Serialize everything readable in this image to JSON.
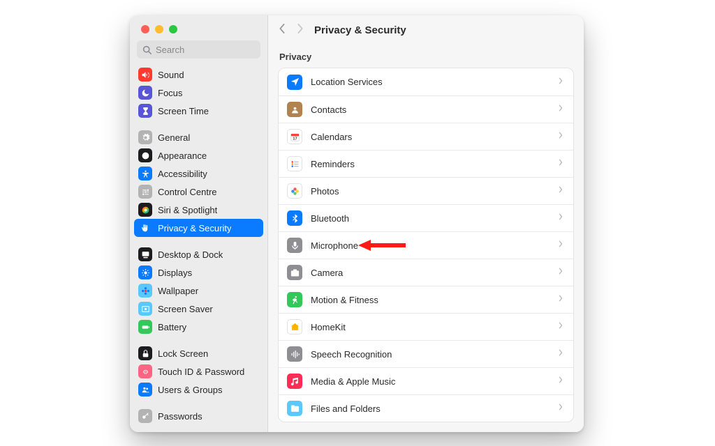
{
  "search": {
    "placeholder": "Search"
  },
  "title": "Privacy & Security",
  "section_header": "Privacy",
  "sidebar": {
    "group1": [
      {
        "label": "Sound",
        "icon": "sound",
        "bg": "#FF3B30"
      },
      {
        "label": "Focus",
        "icon": "moon",
        "bg": "#5856D6"
      },
      {
        "label": "Screen Time",
        "icon": "hourglass",
        "bg": "#5856D6"
      }
    ],
    "group2": [
      {
        "label": "General",
        "icon": "gear",
        "bg": "#B3B3B3"
      },
      {
        "label": "Appearance",
        "icon": "appearance",
        "bg": "#1C1C1E"
      },
      {
        "label": "Accessibility",
        "icon": "access",
        "bg": "#0A7AFF"
      },
      {
        "label": "Control Centre",
        "icon": "sliders",
        "bg": "#B3B3B3"
      },
      {
        "label": "Siri & Spotlight",
        "icon": "siri",
        "bg": "grad-siri"
      },
      {
        "label": "Privacy & Security",
        "icon": "hand",
        "bg": "#0A7AFF",
        "selected": true
      }
    ],
    "group3": [
      {
        "label": "Desktop & Dock",
        "icon": "dock",
        "bg": "#1C1C1E"
      },
      {
        "label": "Displays",
        "icon": "sun",
        "bg": "#0A7AFF"
      },
      {
        "label": "Wallpaper",
        "icon": "flower",
        "bg": "#5AC8FA"
      },
      {
        "label": "Screen Saver",
        "icon": "frame",
        "bg": "#5AC8FA"
      },
      {
        "label": "Battery",
        "icon": "battery",
        "bg": "#34C759"
      }
    ],
    "group4": [
      {
        "label": "Lock Screen",
        "icon": "lock",
        "bg": "#1C1C1E"
      },
      {
        "label": "Touch ID & Password",
        "icon": "finger",
        "bg": "#FF6482"
      },
      {
        "label": "Users & Groups",
        "icon": "users",
        "bg": "#0A7AFF"
      }
    ],
    "group5": [
      {
        "label": "Passwords",
        "icon": "key",
        "bg": "#B3B3B3"
      }
    ]
  },
  "rows": [
    {
      "label": "Location Services",
      "icon": "location",
      "bg": "#0A7AFF"
    },
    {
      "label": "Contacts",
      "icon": "contacts",
      "bg": "#B28250"
    },
    {
      "label": "Calendars",
      "icon": "calendar",
      "bg": "white",
      "fg": "#FF3B30"
    },
    {
      "label": "Reminders",
      "icon": "reminders",
      "bg": "white"
    },
    {
      "label": "Photos",
      "icon": "photos",
      "bg": "white"
    },
    {
      "label": "Bluetooth",
      "icon": "bluetooth",
      "bg": "#0A7AFF"
    },
    {
      "label": "Microphone",
      "icon": "mic",
      "bg": "#8E8E93",
      "annotate": true
    },
    {
      "label": "Camera",
      "icon": "camera",
      "bg": "#8E8E93"
    },
    {
      "label": "Motion & Fitness",
      "icon": "motion",
      "bg": "#34C759"
    },
    {
      "label": "HomeKit",
      "icon": "home",
      "bg": "white",
      "fg": "#FFB300"
    },
    {
      "label": "Speech Recognition",
      "icon": "wave",
      "bg": "#8E8E93"
    },
    {
      "label": "Media & Apple Music",
      "icon": "music",
      "bg": "#FF2D55"
    },
    {
      "label": "Files and Folders",
      "icon": "folder",
      "bg": "#5AC8FA"
    }
  ]
}
